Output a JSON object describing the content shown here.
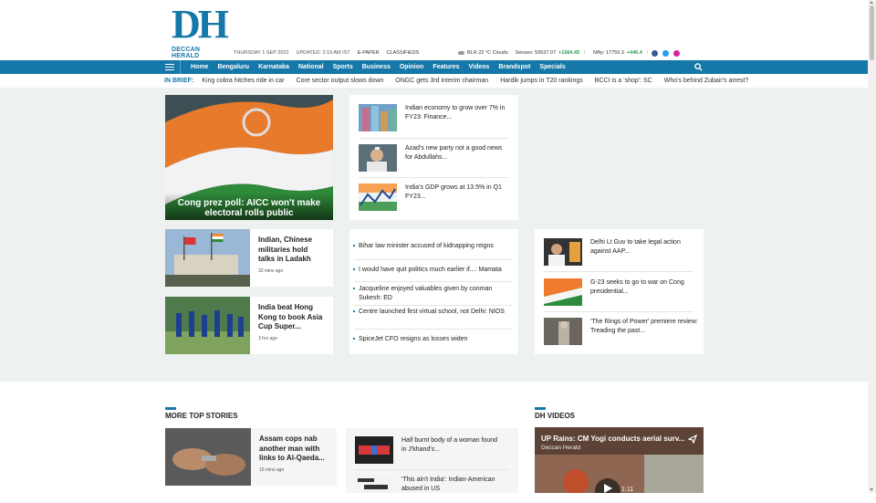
{
  "header": {
    "logo_text": "DH",
    "logo_name": "DECCAN HERALD",
    "date": "THURSDAY 1 SEP 2022",
    "updated": "UPDATED: 2:19 AM IST",
    "epaper": "E-PAPER",
    "classifieds": "CLASSIFIEDS",
    "weather": "BLR 22 °C Clouds",
    "sensex_label": "Sensex: 59537.07",
    "sensex_change": "+1564.45",
    "nifty_label": "Nifty: 17759.3",
    "nifty_change": "+446.4",
    "colors": {
      "brand": "#1678a8",
      "up": "#2a9a54"
    }
  },
  "social": [
    {
      "name": "facebook-icon",
      "color": "#3b5998"
    },
    {
      "name": "twitter-icon",
      "color": "#1da1f2"
    },
    {
      "name": "instagram-icon",
      "color": "#d6249f"
    }
  ],
  "nav": {
    "items": [
      "Home",
      "Bengaluru",
      "Karnataka",
      "National",
      "Sports",
      "Business",
      "Opinion",
      "Features",
      "Videos",
      "Brandspot",
      "Specials"
    ]
  },
  "brief": {
    "label": "IN BRIEF:",
    "items": [
      "King cobra hitches ride in car",
      "Core sector output slows down",
      "ONGC gets 3rd interim chairman",
      "Hardik jumps in T20 rankings",
      "BCCI is a 'shop': SC",
      "Who's behind Zubair's arrest?"
    ]
  },
  "hero": {
    "title": "Cong prez poll: AICC won't make electoral rolls public"
  },
  "mini": [
    {
      "title": "Indian, Chinese militaries hold talks in Ladakh",
      "time": "33 mins ago"
    },
    {
      "title": "India beat Hong Kong to book Asia Cup Super...",
      "time": "3 hrs ago"
    }
  ],
  "middle_list": [
    "Indian economy to grow over 7% in FY23: Finance...",
    "Azad's new party not a good news for Abdullahs...",
    "India's GDP grows at 13.5% in Q1 FY23..."
  ],
  "bullets": [
    "Bihar law minister accused of kidnapping reigns",
    "I would have quit politics much earlier if...: Mamata",
    "Jacqueline enjoyed valuables given by conman Sukesh: ED",
    "Centre launched first virtual school, not Delhi: NIOS",
    "SpiceJet CFO resigns as losses widen"
  ],
  "right_list": [
    "Delhi Lt Guv to take legal action against AAP...",
    "G-23 seeks to go to war on Cong presidential...",
    "'The Rings of Power' premiere review: Treading the past..."
  ],
  "more": {
    "heading": "MORE TOP STORIES",
    "feature": {
      "title": "Assam cops nab another man with links to Al-Qaeda...",
      "time": "10 mins ago"
    },
    "list": [
      "Half burnt body of a woman found in J'khand's...",
      "'This ain't India': Indian-American abused in US"
    ]
  },
  "videos": {
    "heading": "DH VIDEOS",
    "title": "UP Rains: CM Yogi conducts aerial surv...",
    "channel": "Deccan Herald",
    "duration": "1:11"
  }
}
